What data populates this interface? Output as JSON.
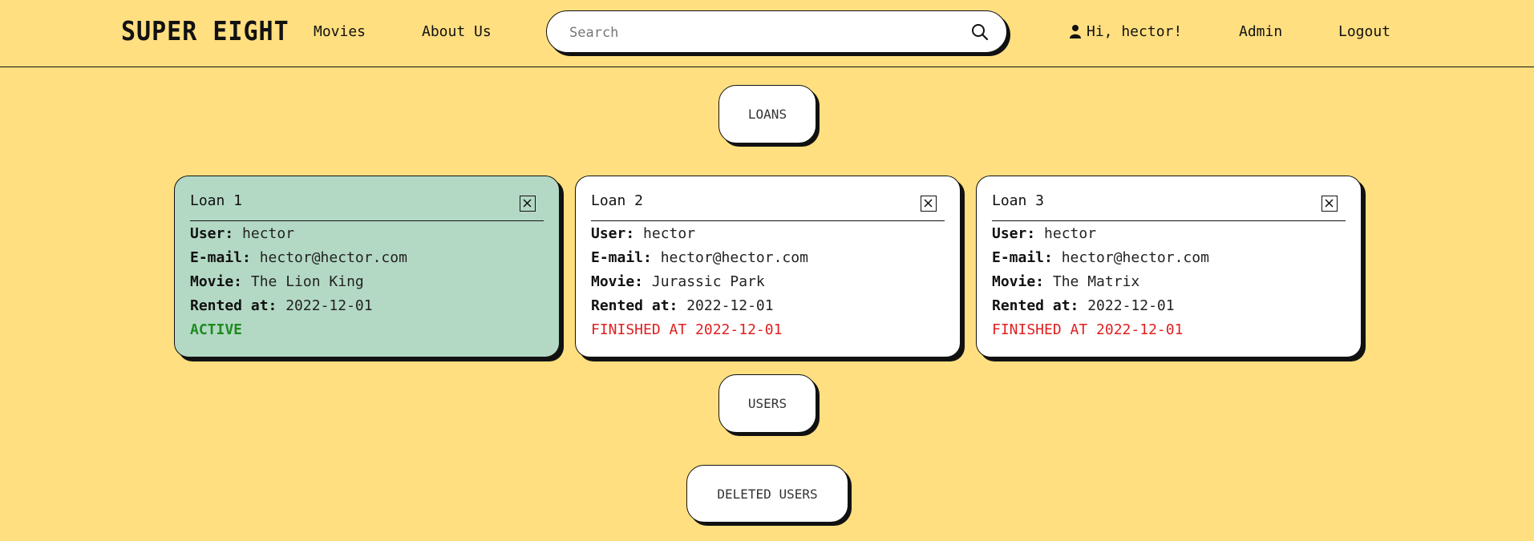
{
  "nav": {
    "brand": "SUPER EIGHT",
    "movies": "Movies",
    "about": "About Us",
    "greeting": "Hi, hector!",
    "admin": "Admin",
    "logout": "Logout"
  },
  "search": {
    "placeholder": "Search",
    "value": ""
  },
  "sections": {
    "loans": "LOANS",
    "users": "USERS",
    "deleted_users": "DELETED USERS"
  },
  "field_labels": {
    "user": "User:",
    "email": "E-mail:",
    "movie": "Movie:",
    "rented": "Rented at:"
  },
  "loans": [
    {
      "title": "Loan 1",
      "user": "hector",
      "email": "hector@hector.com",
      "movie": "The Lion King",
      "rented_at": "2022-12-01",
      "status": "ACTIVE"
    },
    {
      "title": "Loan 2",
      "user": "hector",
      "email": "hector@hector.com",
      "movie": "Jurassic Park",
      "rented_at": "2022-12-01",
      "status": "FINISHED AT 2022-12-01"
    },
    {
      "title": "Loan 3",
      "user": "hector",
      "email": "hector@hector.com",
      "movie": "The Matrix",
      "rented_at": "2022-12-01",
      "status": "FINISHED AT 2022-12-01"
    }
  ],
  "colors": {
    "background": "#ffdf80",
    "active_card": "#b3d9c4",
    "active_status": "#1f8a1f",
    "finished_status": "#e02020"
  }
}
